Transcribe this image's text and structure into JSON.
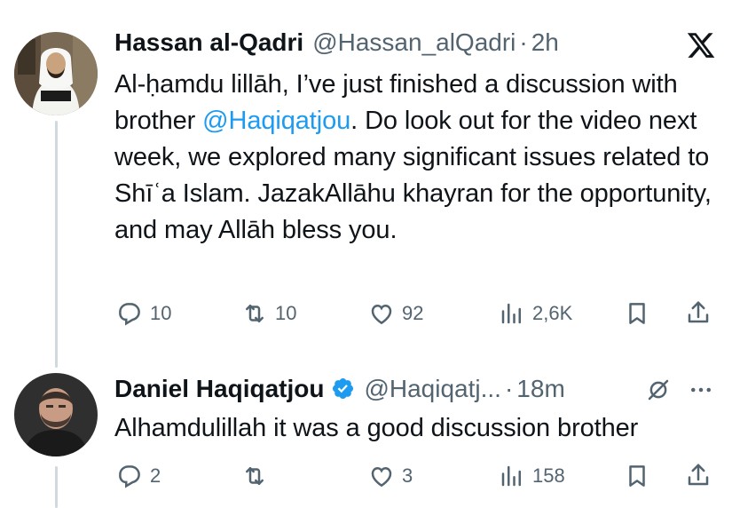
{
  "tweet1": {
    "name": "Hassan al-Qadri",
    "handle": "@Hassan_alQadri",
    "separator": "·",
    "time": "2h",
    "text_pre": "Al-ḥamdu lillāh, I’ve just finished a discussion with brother ",
    "mention": "@Haqiqatjou",
    "text_post": ". Do look out for the video next week, we explored many significant issues related to Shīʿa Islam. JazakAllāhu khayran for the opportunity, and may Allāh bless you.",
    "replies": "10",
    "reposts": "10",
    "likes": "92",
    "views": "2,6K"
  },
  "tweet2": {
    "name": "Daniel Haqiqatjou",
    "handle": "@Haqiqatj...",
    "separator": "·",
    "time": "18m",
    "text": "Alhamdulillah it was a good discussion brother",
    "replies": "2",
    "reposts": "",
    "likes": "3",
    "views": "158"
  },
  "icons": {
    "brand": "x-logo-icon",
    "reply": "reply-icon",
    "repost": "repost-icon",
    "like": "heart-icon",
    "views": "views-icon",
    "bookmark": "bookmark-icon",
    "share": "share-icon",
    "verified": "verified-badge-icon",
    "grok": "grok-icon",
    "more": "more-icon"
  },
  "colors": {
    "text": "#0f1419",
    "secondary": "#536471",
    "link": "#1d9bf0",
    "thread_line": "#cfd9de"
  }
}
